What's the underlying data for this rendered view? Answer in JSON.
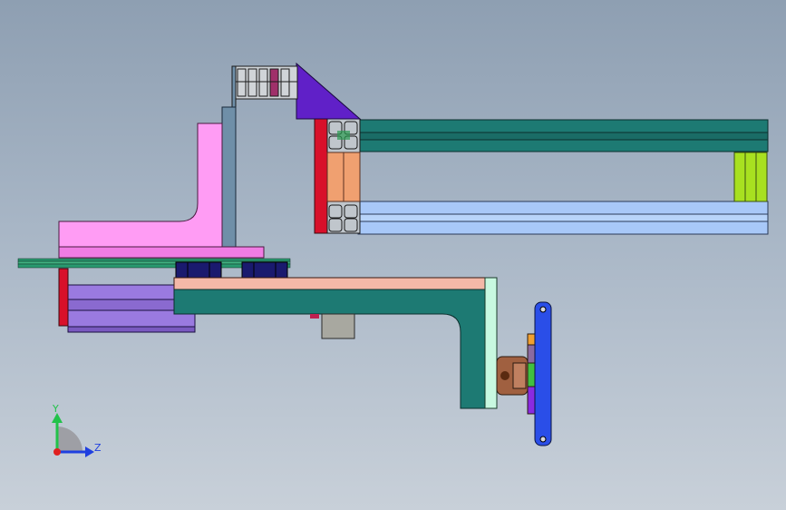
{
  "triad": {
    "y_label": "Y",
    "z_label": "Z",
    "y_color": "#22c24a",
    "z_color": "#1f3fe0",
    "x_color": "#e02020"
  },
  "colors": {
    "background_top": "#8e9fb2",
    "background_bottom": "#c8d0d9",
    "teal": "#1d7a73",
    "dark_teal": "#14625c",
    "light_blue": "#a8c8f8",
    "pink": "#ff9cf4",
    "salmon": "#f4b8a8",
    "navy": "#1a1a6e",
    "purple": "#9a7ae0",
    "red": "#d8102a",
    "indigo": "#6020c8",
    "blue": "#2a4ee8",
    "lime": "#a8e020",
    "orange_block": "#f0a070",
    "steel_blue": "#6f8fa8",
    "mint": "#c8f8e0",
    "gray": "#a8a8a0",
    "copper": "#a06040"
  }
}
